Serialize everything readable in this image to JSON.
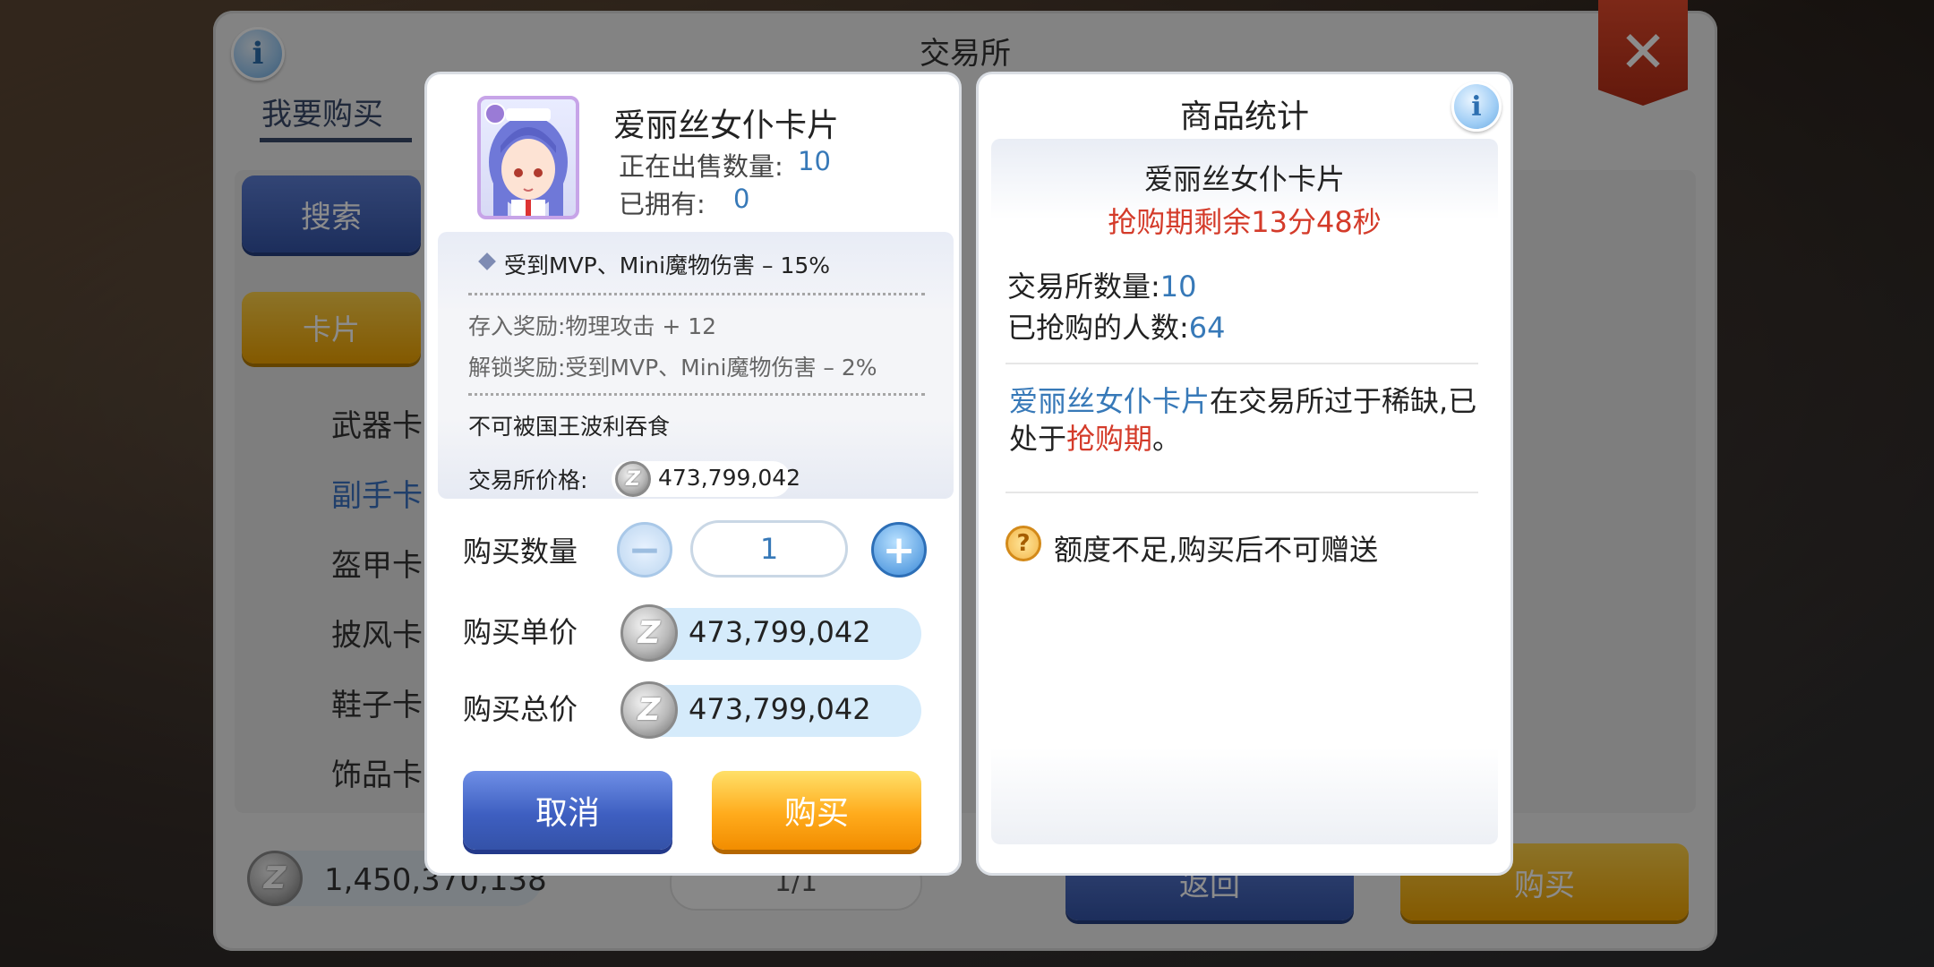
{
  "background_window": {
    "title": "交易所",
    "tab_buy": "我要购买",
    "search_label": "搜索",
    "card_label": "卡片",
    "categories": [
      "武器卡",
      "副手卡",
      "盔甲卡",
      "披风卡",
      "鞋子卡",
      "饰品卡"
    ],
    "money": "1,450,370,138",
    "page": "1/1",
    "return_label": "返回",
    "buy_label": "购买"
  },
  "purchase_dialog": {
    "item_name": "爱丽丝女仆卡片",
    "on_sale_label": "正在出售数量:",
    "on_sale_value": "10",
    "owned_label": "已拥有:",
    "owned_value": "0",
    "effect": "受到MVP、Mini魔物伤害 – 15%",
    "deposit_reward": "存入奖励:物理攻击 + 12",
    "unlock_reward": "解锁奖励:受到MVP、Mini魔物伤害 – 2%",
    "note": "不可被国王波利吞食",
    "exchange_price_label": "交易所价格:",
    "exchange_price": "473,799,042",
    "quantity_label": "购买数量",
    "quantity_value": "1",
    "unit_price_label": "购买单价",
    "unit_price": "473,799,042",
    "total_price_label": "购买总价",
    "total_price": "473,799,042",
    "cancel_label": "取消",
    "buy_label": "购买"
  },
  "stats_dialog": {
    "title": "商品统计",
    "item_name": "爱丽丝女仆卡片",
    "timer": "抢购期剩余13分48秒",
    "exchange_count_label": "交易所数量:",
    "exchange_count_value": "10",
    "buyers_label": "已抢购的人数:",
    "buyers_value": "64",
    "para_item": "爱丽丝女仆卡片",
    "para_mid": "在交易所过于稀缺,已处于",
    "para_period": "抢购期",
    "para_end": "。",
    "warning": "额度不足,购买后不可赠送"
  },
  "icons": {
    "info": "info-icon",
    "close": "close-icon",
    "coin": "zeny-coin-icon",
    "warning": "question-icon"
  },
  "colors": {
    "blue_value": "#3779b8",
    "red_alert": "#d43b2a",
    "cancel_button": "#3e5fc1",
    "buy_button": "#ffab1c"
  }
}
